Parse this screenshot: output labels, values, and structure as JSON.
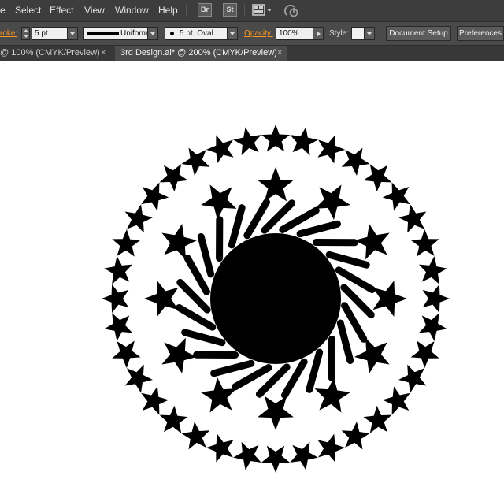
{
  "menu": {
    "items": [
      "Select",
      "Effect",
      "View",
      "Window",
      "Help"
    ],
    "partial_first": "e",
    "bridge_label": "Br",
    "stock_label": "St"
  },
  "control_bar": {
    "stroke_label": "roke:",
    "stroke_weight": "5 pt",
    "stroke_profile": "Uniform",
    "brush_definition": "5 pt. Oval",
    "opacity_label": "Opacity:",
    "opacity_value": "100%",
    "style_label": "Style:",
    "document_setup": "Document Setup",
    "preferences": "Preferences"
  },
  "tabs": [
    {
      "label": "@ 100% (CMYK/Preview)",
      "active": false
    },
    {
      "label": "3rd Design.ai* @ 200% (CMYK/Preview)",
      "active": true
    }
  ],
  "tab_close_glyph": "×",
  "artwork": {
    "fill_color": "#000000",
    "outer_ring_star_count": 36,
    "inner_ring_star_count": 12,
    "dash_count": 24
  }
}
